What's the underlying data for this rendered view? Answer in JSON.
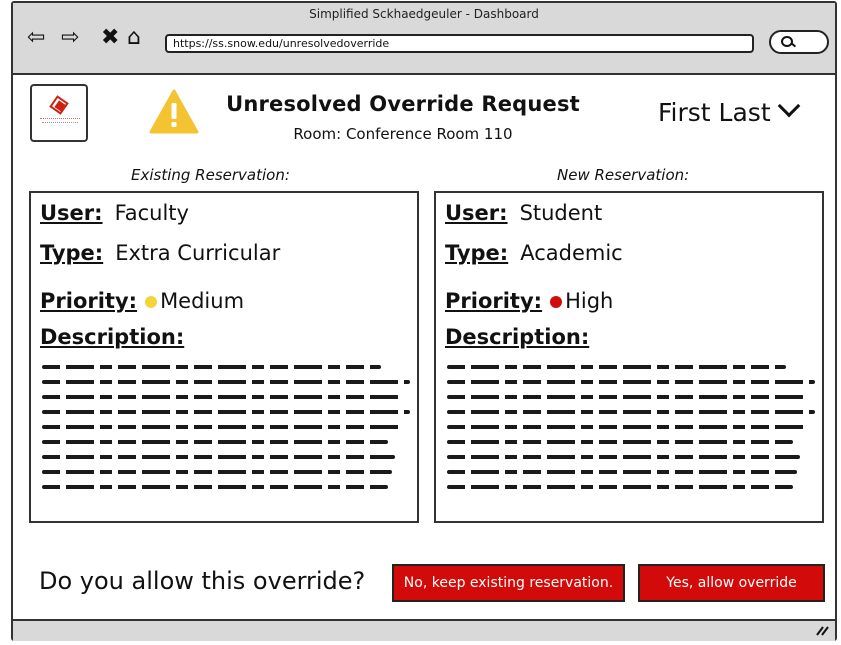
{
  "window": {
    "title": "Simplified Sckhaedgeuler - Dashboard"
  },
  "browser": {
    "url": "https://ss.snow.edu/unresolvedoverride",
    "back_glyph": "⇦",
    "forward_glyph": "⇨",
    "stop_glyph": "✖",
    "home_glyph": "⌂"
  },
  "header": {
    "title": "Unresolved Override Request",
    "room": "Room: Conference Room 110",
    "user_name": "First Last"
  },
  "existing": {
    "heading": "Existing Reservation:",
    "user_label": "User:",
    "user": "Faculty",
    "type_label": "Type:",
    "type": "Extra Curricular",
    "priority_label": "Priority:",
    "priority": "Medium",
    "priority_color": "#f5d33b",
    "description_label": "Description:"
  },
  "incoming": {
    "heading": "New Reservation:",
    "user_label": "User:",
    "user": "Student",
    "type_label": "Type:",
    "type": "Academic",
    "priority_label": "Priority:",
    "priority": "High",
    "priority_color": "#d10d0d",
    "description_label": "Description:"
  },
  "footer": {
    "question": "Do you allow this override?",
    "deny_label": "No, keep existing reservation.",
    "allow_label": "Yes, allow override"
  },
  "colors": {
    "accent_button": "#d20a0a",
    "chrome": "#d9d9d9",
    "warning": "#f3c332"
  },
  "icons": [
    "back-arrow-icon",
    "forward-arrow-icon",
    "stop-icon",
    "home-icon",
    "search-icon",
    "logo",
    "warning-icon",
    "chevron-down-icon",
    "resize-grip-icon"
  ]
}
